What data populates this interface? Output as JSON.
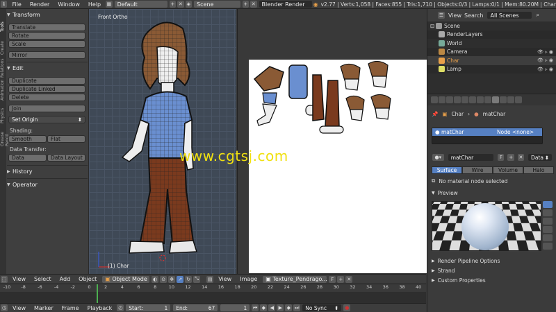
{
  "topbar": {
    "menus": [
      "File",
      "Render",
      "Window",
      "Help"
    ],
    "layout": "Default",
    "scene": "Scene",
    "engine": "Blender Render",
    "stats": "v2.77 | Verts:1,058 | Faces:855 | Tris:1,710 | Objects:0/3 | Lamps:0/1 | Mem:80.20M | Char"
  },
  "toolshelf": {
    "tabs": [
      "Tools",
      "Create",
      "Relations",
      "Animation",
      "Physics",
      "Grease Pencil"
    ],
    "transform_title": "Transform",
    "translate": "Translate",
    "rotate": "Rotate",
    "scale": "Scale",
    "mirror": "Mirror",
    "edit_title": "Edit",
    "duplicate": "Duplicate",
    "duplicate_linked": "Duplicate Linked",
    "delete": "Delete",
    "join": "Join",
    "set_origin": "Set Origin",
    "shading_label": "Shading:",
    "smooth": "Smooth",
    "flat": "Flat",
    "data_transfer_label": "Data Transfer:",
    "data": "Data",
    "data_layout": "Data Layout",
    "history_title": "History",
    "operator_title": "Operator"
  },
  "viewport": {
    "title": "Front Ortho",
    "object_label": "(1) Char"
  },
  "watermark": "www.cgtsj.com",
  "outliner": {
    "view": "View",
    "search": "Search",
    "filter": "All Scenes",
    "items": [
      "Scene",
      "RenderLayers",
      "World",
      "Camera",
      "Char",
      "Lamp"
    ]
  },
  "properties": {
    "breadcrumb_object": "Char",
    "breadcrumb_material": "matChar",
    "slot_name": "matChar",
    "node_label": "Node <none>",
    "material_field": "matChar",
    "data_label": "Data",
    "tabs": [
      "Surface",
      "Wire",
      "Volume",
      "Halo"
    ],
    "no_node": "No material node selected",
    "preview_title": "Preview",
    "render_pipeline": "Render Pipeline Options",
    "strand": "Strand",
    "custom_properties": "Custom Properties"
  },
  "viewport_header": {
    "view": "View",
    "select": "Select",
    "add": "Add",
    "object": "Object",
    "mode": "Object Mode",
    "img_view": "View",
    "img_image": "Image",
    "img_name": "Texture_Pendrago..."
  },
  "timeline": {
    "ticks": [
      "-10",
      "-8",
      "-6",
      "-4",
      "-2",
      "0",
      "2",
      "4",
      "6",
      "8",
      "10",
      "12",
      "14",
      "16",
      "18",
      "20",
      "22",
      "24",
      "26",
      "28",
      "30",
      "32",
      "34",
      "36",
      "38",
      "40"
    ],
    "view": "View",
    "marker": "Marker",
    "frame": "Frame",
    "playback": "Playback",
    "start_label": "Start:",
    "start_value": "1",
    "end_label": "End:",
    "end_value": "67",
    "current": "1",
    "sync": "No Sync"
  },
  "colors": {
    "accent": "#5680c2",
    "viewport_bg": "#3f4956",
    "shirt": "#6a8fd0",
    "pants": "#7a3a1e",
    "hair": "#8a5a35"
  }
}
